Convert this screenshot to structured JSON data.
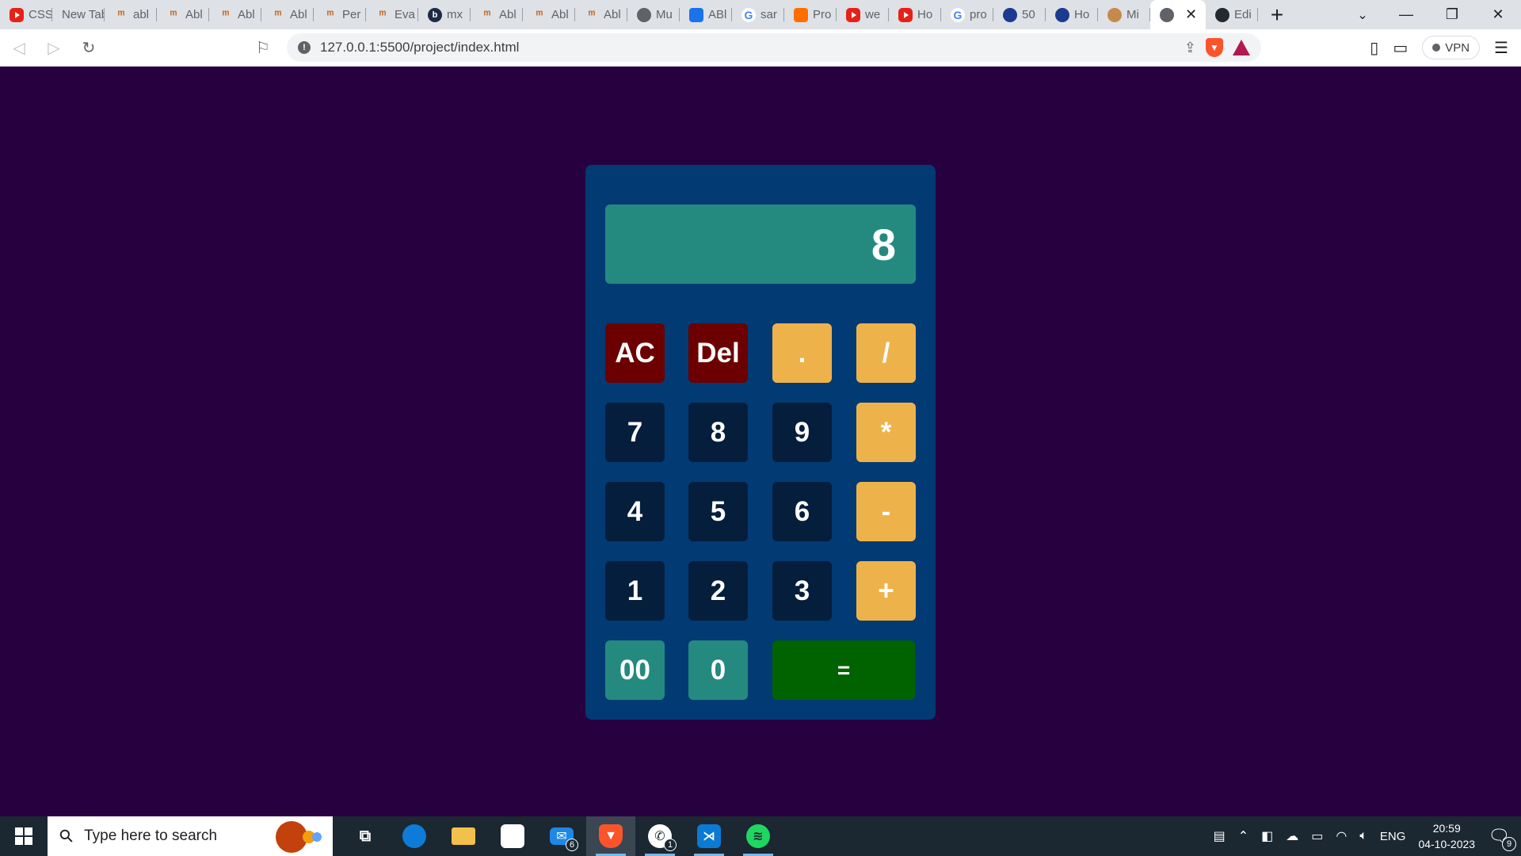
{
  "browser": {
    "tabs": [
      {
        "title": "CSS",
        "icon": "youtube-icon"
      },
      {
        "title": "New Tab",
        "icon": "none"
      },
      {
        "title": "abl",
        "icon": "fm-icon"
      },
      {
        "title": "Abl",
        "icon": "fm-icon"
      },
      {
        "title": "Abl",
        "icon": "fm-icon"
      },
      {
        "title": "Abl",
        "icon": "fm-icon"
      },
      {
        "title": "Per",
        "icon": "fm-icon"
      },
      {
        "title": "Eva",
        "icon": "fm-icon"
      },
      {
        "title": "mx",
        "icon": "b-icon"
      },
      {
        "title": "Abl",
        "icon": "fm-icon"
      },
      {
        "title": "Abl",
        "icon": "fm-icon"
      },
      {
        "title": "Abl",
        "icon": "fm-icon"
      },
      {
        "title": "Mu",
        "icon": "globe-icon"
      },
      {
        "title": "ABl",
        "icon": "chart-icon"
      },
      {
        "title": "sar",
        "icon": "google-icon"
      },
      {
        "title": "Pro",
        "icon": "pen-icon"
      },
      {
        "title": "we",
        "icon": "youtube-icon"
      },
      {
        "title": "Ho",
        "icon": "youtube-icon"
      },
      {
        "title": "pro",
        "icon": "google-icon"
      },
      {
        "title": "50",
        "icon": "round-icon"
      },
      {
        "title": "Ho",
        "icon": "round-icon"
      },
      {
        "title": "Mi",
        "icon": "dog-icon"
      },
      {
        "title": "",
        "icon": "globe-icon",
        "active": true
      },
      {
        "title": "Edi",
        "icon": "github-icon"
      }
    ],
    "close_glyph": "✕",
    "new_tab_glyph": "+",
    "url": "127.0.0.1:5500/project/index.html",
    "vpn_label": "VPN",
    "window_controls": {
      "minimize": "—",
      "maximize": "❐",
      "close": "✕"
    }
  },
  "calculator": {
    "display": "8",
    "keys": {
      "ac": "AC",
      "del": "Del",
      "dot": ".",
      "divide": "/",
      "seven": "7",
      "eight": "8",
      "nine": "9",
      "multiply": "*",
      "four": "4",
      "five": "5",
      "six": "6",
      "minus": "-",
      "one": "1",
      "two": "2",
      "three": "3",
      "plus": "+",
      "double_zero": "00",
      "zero": "0",
      "equals": "="
    },
    "colors": {
      "page_bg": "#27003f",
      "body_bg": "#023a73",
      "display_bg": "#248a80",
      "clear_keys": "#6c0000",
      "operator_keys": "#eeb24b",
      "number_keys": "#051e3c",
      "equals_key": "#006300"
    }
  },
  "taskbar": {
    "search_placeholder": "Type here to search",
    "apps": [
      {
        "name": "task-view",
        "badge": ""
      },
      {
        "name": "edge",
        "badge": ""
      },
      {
        "name": "file-explorer",
        "badge": ""
      },
      {
        "name": "store",
        "badge": ""
      },
      {
        "name": "mail",
        "badge": "6"
      },
      {
        "name": "brave",
        "badge": ""
      },
      {
        "name": "whatsapp",
        "badge": "1"
      },
      {
        "name": "vscode",
        "badge": ""
      },
      {
        "name": "spotify",
        "badge": ""
      }
    ],
    "language": "ENG",
    "time": "20:59",
    "date": "04-10-2023",
    "notifications": "9"
  }
}
